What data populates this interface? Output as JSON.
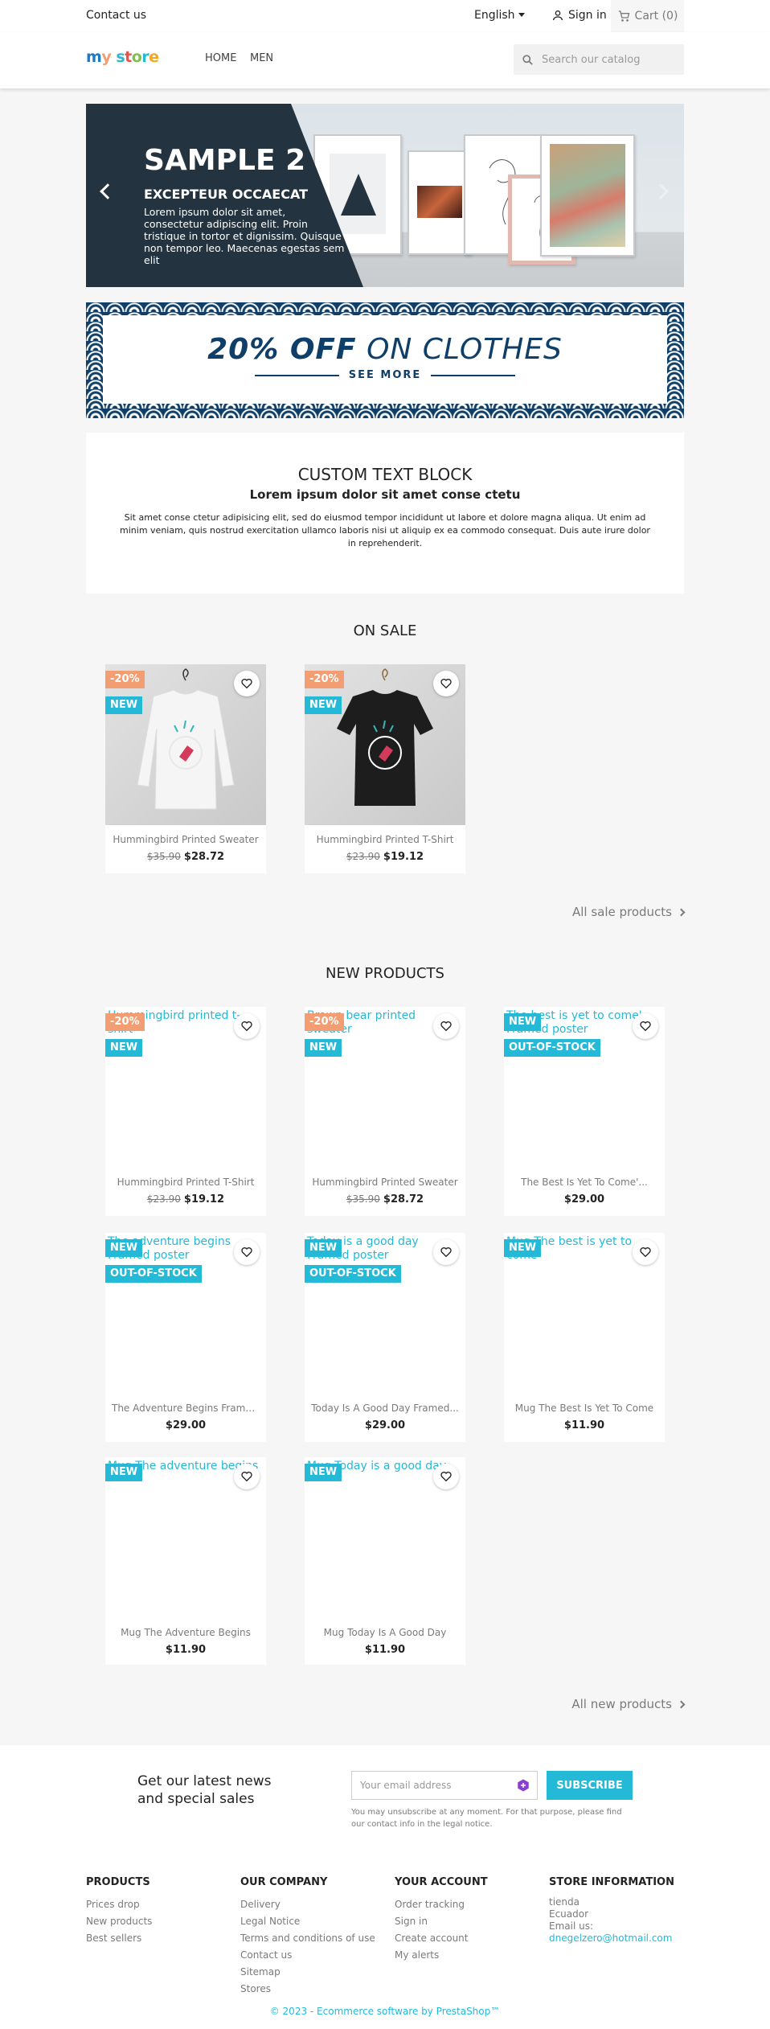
{
  "topbar": {
    "contact": "Contact us",
    "language": "English",
    "signin": "Sign in",
    "cart": "Cart (0)"
  },
  "header": {
    "logo_parts": [
      "my",
      " ",
      "store"
    ],
    "logo_colors": [
      "#1e78c8",
      "#f39d72",
      "#2fb5d2",
      "#e9524c",
      "#7fbf4d",
      "#24b9d7",
      "#f5a623",
      "#f39d72"
    ],
    "nav": [
      "HOME",
      "MEN"
    ],
    "search_placeholder": "Search our catalog"
  },
  "slider": {
    "title": "SAMPLE 2",
    "subtitle": "EXCEPTEUR OCCAECAT",
    "text": "Lorem ipsum dolor sit amet, consectetur adipiscing elit. Proin tristique in tortor et dignissim. Quisque non tempor leo. Maecenas egestas sem elit"
  },
  "promo": {
    "strong": "20% OFF",
    "rest": " ON CLOTHES",
    "cta": "SEE MORE"
  },
  "custom_block": {
    "title": "CUSTOM TEXT BLOCK",
    "subtitle": "Lorem ipsum dolor sit amet conse ctetu",
    "text": "Sit amet conse ctetur adipisicing elit, sed do eiusmod tempor incididunt ut labore et dolore magna aliqua. Ut enim ad minim veniam, quis nostrud exercitation ullamco laboris nisi ut aliquip ex ea commodo consequat. Duis aute irure dolor in reprehenderit."
  },
  "on_sale": {
    "title": "ON SALE",
    "link": "All sale products",
    "products": [
      {
        "name": "Hummingbird Printed Sweater",
        "regular": "$35.90",
        "price": "$28.72",
        "discount": "-20%",
        "new": "NEW"
      },
      {
        "name": "Hummingbird Printed T-Shirt",
        "regular": "$23.90",
        "price": "$19.12",
        "discount": "-20%",
        "new": "NEW"
      }
    ]
  },
  "new_products": {
    "title": "NEW PRODUCTS",
    "link": "All new products",
    "products": [
      {
        "alt": "Hummingbird printed t-shirt",
        "name": "Hummingbird Printed T-Shirt",
        "regular": "$23.90",
        "price": "$19.12",
        "discount": "-20%",
        "new": "NEW"
      },
      {
        "alt": "Brown bear printed sweater",
        "name": "Hummingbird Printed Sweater",
        "regular": "$35.90",
        "price": "$28.72",
        "discount": "-20%",
        "new": "NEW"
      },
      {
        "alt": "The best is yet to come' Framed poster",
        "name": "The Best Is Yet To Come'...",
        "price": "$29.00",
        "new": "NEW",
        "oos": "OUT-OF-STOCK"
      },
      {
        "alt": "The adventure begins Framed poster",
        "name": "The Adventure Begins Framed...",
        "price": "$29.00",
        "new": "NEW",
        "oos": "OUT-OF-STOCK"
      },
      {
        "alt": "Today is a good day Framed poster",
        "name": "Today Is A Good Day Framed...",
        "price": "$29.00",
        "new": "NEW",
        "oos": "OUT-OF-STOCK"
      },
      {
        "alt": "Mug The best is yet to come",
        "name": "Mug The Best Is Yet To Come",
        "price": "$11.90",
        "new": "NEW"
      },
      {
        "alt": "Mug The adventure begins",
        "name": "Mug The Adventure Begins",
        "price": "$11.90",
        "new": "NEW"
      },
      {
        "alt": "Mug Today is a good day",
        "name": "Mug Today Is A Good Day",
        "price": "$11.90",
        "new": "NEW"
      }
    ]
  },
  "newsletter": {
    "title": "Get our latest news and special sales",
    "placeholder": "Your email address",
    "button": "SUBSCRIBE",
    "note": "You may unsubscribe at any moment. For that purpose, please find our contact info in the legal notice."
  },
  "footer": {
    "products": {
      "title": "PRODUCTS",
      "links": [
        "Prices drop",
        "New products",
        "Best sellers"
      ]
    },
    "company": {
      "title": "OUR COMPANY",
      "links": [
        "Delivery",
        "Legal Notice",
        "Terms and conditions of use",
        "Contact us",
        "Sitemap",
        "Stores"
      ]
    },
    "account": {
      "title": "YOUR ACCOUNT",
      "links": [
        "Order tracking",
        "Sign in",
        "Create account",
        "My alerts"
      ]
    },
    "store": {
      "title": "STORE INFORMATION",
      "lines": [
        "tienda",
        "Ecuador",
        "Email us:"
      ],
      "email": "dnegelzero@hotmail.com"
    },
    "copyright": "© 2023 - Ecommerce software by PrestaShop™"
  },
  "colors": {
    "accent": "#24b9d7",
    "discount": "#f39d72",
    "promo_navy": "#0f3f68",
    "slider_dark": "#233340"
  }
}
